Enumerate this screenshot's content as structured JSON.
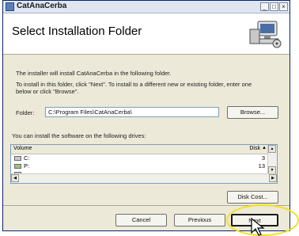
{
  "window": {
    "title": "CatAnaCerba",
    "controls": {
      "minimize": "_",
      "maximize": "□",
      "close": "×"
    }
  },
  "header": {
    "page_title": "Select Installation Folder",
    "art_icon": "computer-setup-icon"
  },
  "intro": {
    "line1": "The installer will install CatAnaCerba in the following folder.",
    "line2a": "To install in this folder, click \"Next\". To install to a different new or existing folder, enter one",
    "line2b": "below or click \"Browse\"."
  },
  "folder": {
    "label": "Folder:",
    "value": "C:\\Program Files\\CatAnaCerba\\",
    "browse_label": "Browse..."
  },
  "drives": {
    "instruction": "You can install the software on the following drives:",
    "columns": {
      "volume": "Volume",
      "disk": "Disk"
    },
    "rows": [
      {
        "name": "C:",
        "value": "3",
        "icon": "hard-drive-icon"
      },
      {
        "name": "P:",
        "value": "13",
        "icon": "network-drive-icon"
      },
      {
        "name": "",
        "value": "",
        "icon": "hard-drive-icon"
      }
    ],
    "disk_cost_label": "Disk Cost..."
  },
  "footer": {
    "cancel_label": "Cancel",
    "previous_label": "Previous",
    "next_label": "Next"
  },
  "colors": {
    "dialog_face": "#ece9d8",
    "highlight_ring": "#f2e21a",
    "border_blue": "#7f9db9"
  }
}
